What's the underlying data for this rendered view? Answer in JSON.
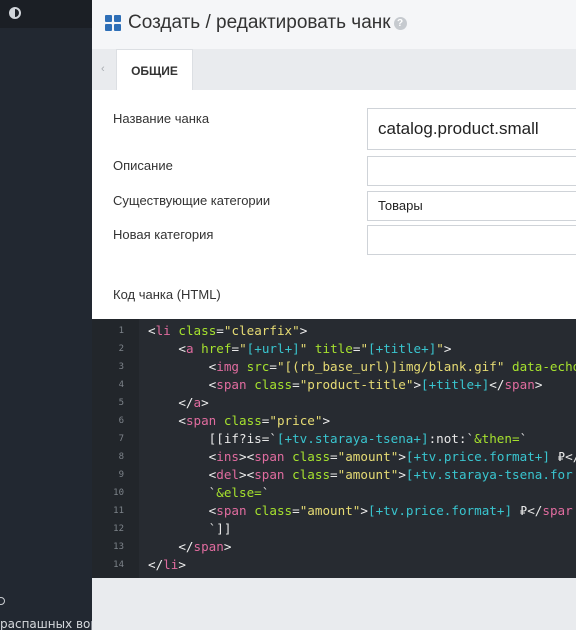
{
  "sidebar": {
    "bottom_text": "распашных ворот"
  },
  "header": {
    "title": "Создать / редактировать чанк",
    "help_glyph": "?"
  },
  "tabs": [
    {
      "label": "ОБЩИЕ",
      "active": true
    }
  ],
  "form": {
    "name_label": "Название чанка",
    "name_value": "catalog.product.small",
    "description_label": "Описание",
    "description_value": "",
    "existing_category_label": "Существующие категории",
    "existing_category_value": "Товары",
    "new_category_label": "Новая категория",
    "new_category_value": "",
    "code_label": "Код чанка (HTML)"
  },
  "editor": {
    "lines": [
      {
        "n": "1",
        "parts": [
          [
            "tg",
            "<"
          ],
          [
            "nm",
            "li"
          ],
          [
            "tx",
            " "
          ],
          [
            "at",
            "class"
          ],
          [
            "tx",
            "="
          ],
          [
            "sv",
            "\"clearfix\""
          ],
          [
            "tg",
            ">"
          ]
        ]
      },
      {
        "n": "2",
        "parts": [
          [
            "tx",
            "    "
          ],
          [
            "tg",
            "<"
          ],
          [
            "nm",
            "a"
          ],
          [
            "tx",
            " "
          ],
          [
            "at",
            "href"
          ],
          [
            "tx",
            "="
          ],
          [
            "sv",
            "\""
          ],
          [
            "ph",
            "[+url+]"
          ],
          [
            "sv",
            "\""
          ],
          [
            "tx",
            " "
          ],
          [
            "at",
            "title"
          ],
          [
            "tx",
            "="
          ],
          [
            "sv",
            "\""
          ],
          [
            "ph",
            "[+title+]"
          ],
          [
            "sv",
            "\""
          ],
          [
            "tg",
            ">"
          ]
        ]
      },
      {
        "n": "3",
        "parts": [
          [
            "tx",
            "        "
          ],
          [
            "tg",
            "<"
          ],
          [
            "nm",
            "img"
          ],
          [
            "tx",
            " "
          ],
          [
            "at",
            "src"
          ],
          [
            "tx",
            "="
          ],
          [
            "sv",
            "\"[(rb_base_url)]img/blank.gif\""
          ],
          [
            "tx",
            " "
          ],
          [
            "at",
            "data-echo"
          ]
        ]
      },
      {
        "n": "4",
        "parts": [
          [
            "tx",
            "        "
          ],
          [
            "tg",
            "<"
          ],
          [
            "nm",
            "span"
          ],
          [
            "tx",
            " "
          ],
          [
            "at",
            "class"
          ],
          [
            "tx",
            "="
          ],
          [
            "sv",
            "\"product-title\""
          ],
          [
            "tg",
            ">"
          ],
          [
            "ph",
            "[+title+]"
          ],
          [
            "tg",
            "</"
          ],
          [
            "nm",
            "span"
          ],
          [
            "tg",
            ">"
          ]
        ]
      },
      {
        "n": "5",
        "parts": [
          [
            "tx",
            "    "
          ],
          [
            "tg",
            "</"
          ],
          [
            "nm",
            "a"
          ],
          [
            "tg",
            ">"
          ]
        ]
      },
      {
        "n": "6",
        "parts": [
          [
            "tx",
            "    "
          ],
          [
            "tg",
            "<"
          ],
          [
            "nm",
            "span"
          ],
          [
            "tx",
            " "
          ],
          [
            "at",
            "class"
          ],
          [
            "tx",
            "="
          ],
          [
            "sv",
            "\"price\""
          ],
          [
            "tg",
            ">"
          ]
        ]
      },
      {
        "n": "7",
        "parts": [
          [
            "tx",
            "        [[if?is=`"
          ],
          [
            "ph",
            "[+tv.staraya-tsena+]"
          ],
          [
            "tx",
            ":not:`"
          ],
          [
            "at",
            "&then="
          ],
          [
            "tx",
            "`"
          ]
        ]
      },
      {
        "n": "8",
        "parts": [
          [
            "tx",
            "        "
          ],
          [
            "tg",
            "<"
          ],
          [
            "nm",
            "ins"
          ],
          [
            "tg",
            "><"
          ],
          [
            "nm",
            "span"
          ],
          [
            "tx",
            " "
          ],
          [
            "at",
            "class"
          ],
          [
            "tx",
            "="
          ],
          [
            "sv",
            "\"amount\""
          ],
          [
            "tg",
            ">"
          ],
          [
            "ph",
            "[+tv.price.format+]"
          ],
          [
            "tx",
            " ₽</"
          ]
        ]
      },
      {
        "n": "9",
        "parts": [
          [
            "tx",
            "        "
          ],
          [
            "tg",
            "<"
          ],
          [
            "nm",
            "del"
          ],
          [
            "tg",
            "><"
          ],
          [
            "nm",
            "span"
          ],
          [
            "tx",
            " "
          ],
          [
            "at",
            "class"
          ],
          [
            "tx",
            "="
          ],
          [
            "sv",
            "\"amount\""
          ],
          [
            "tg",
            ">"
          ],
          [
            "ph",
            "[+tv.staraya-tsena.for"
          ]
        ]
      },
      {
        "n": "10",
        "parts": [
          [
            "tx",
            "        `"
          ],
          [
            "at",
            "&else="
          ],
          [
            "tx",
            "`"
          ]
        ]
      },
      {
        "n": "11",
        "parts": [
          [
            "tx",
            "        "
          ],
          [
            "tg",
            "<"
          ],
          [
            "nm",
            "span"
          ],
          [
            "tx",
            " "
          ],
          [
            "at",
            "class"
          ],
          [
            "tx",
            "="
          ],
          [
            "sv",
            "\"amount\""
          ],
          [
            "tg",
            ">"
          ],
          [
            "ph",
            "[+tv.price.format+]"
          ],
          [
            "tx",
            " ₽</"
          ],
          [
            "nm",
            "spar"
          ]
        ]
      },
      {
        "n": "12",
        "parts": [
          [
            "tx",
            "        `]]"
          ]
        ]
      },
      {
        "n": "13",
        "parts": [
          [
            "tx",
            "    "
          ],
          [
            "tg",
            "</"
          ],
          [
            "nm",
            "span"
          ],
          [
            "tg",
            ">"
          ]
        ]
      },
      {
        "n": "14",
        "parts": [
          [
            "tg",
            "</"
          ],
          [
            "nm",
            "li"
          ],
          [
            "tg",
            ">"
          ]
        ]
      }
    ]
  }
}
